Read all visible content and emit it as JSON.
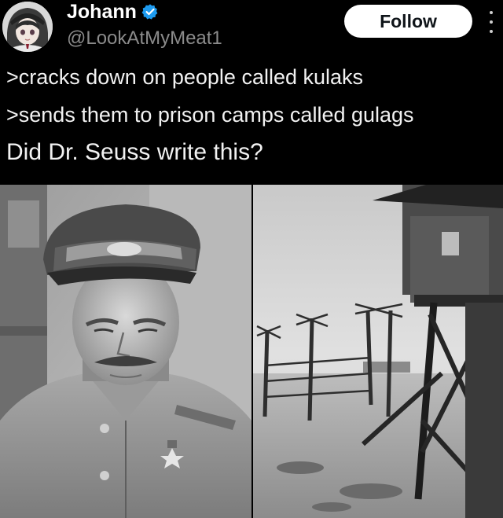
{
  "post": {
    "author": {
      "display_name": "Johann",
      "handle": "@LookAtMyMeat1",
      "verified_icon": "verified-badge-icon",
      "verified_color": "#1d9bf0"
    },
    "follow_label": "Follow",
    "text_lines": [
      ">cracks down on people called kulaks",
      ">sends them to prison camps called gulags",
      "Did Dr. Seuss  write this?"
    ],
    "media": {
      "left_image": "portrait of a uniformed man in a peaked cap",
      "right_image": "prison camp watchtower and barbed wire fence posts"
    }
  }
}
